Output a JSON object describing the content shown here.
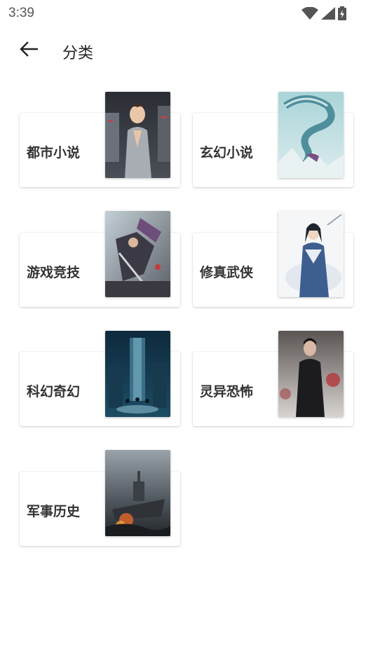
{
  "status_bar": {
    "time": "3:39",
    "icons": [
      "wifi-icon",
      "signal-icon",
      "battery-charging-icon"
    ]
  },
  "app_bar": {
    "back_icon": "arrow-left-icon",
    "title": "分类"
  },
  "categories": [
    {
      "label": "都市小说",
      "cover": "urban-man-cover"
    },
    {
      "label": "玄幻小说",
      "cover": "ice-dragon-cover"
    },
    {
      "label": "游戏竞技",
      "cover": "game-warriors-cover"
    },
    {
      "label": "修真武侠",
      "cover": "swordsman-cover"
    },
    {
      "label": "科幻奇幻",
      "cover": "scifi-tower-cover"
    },
    {
      "label": "灵异恐怖",
      "cover": "dark-figure-cover"
    },
    {
      "label": "军事历史",
      "cover": "warship-cover"
    }
  ],
  "colors": {
    "background": "#ffffff",
    "card_text": "#333333",
    "status_text": "#555555"
  }
}
